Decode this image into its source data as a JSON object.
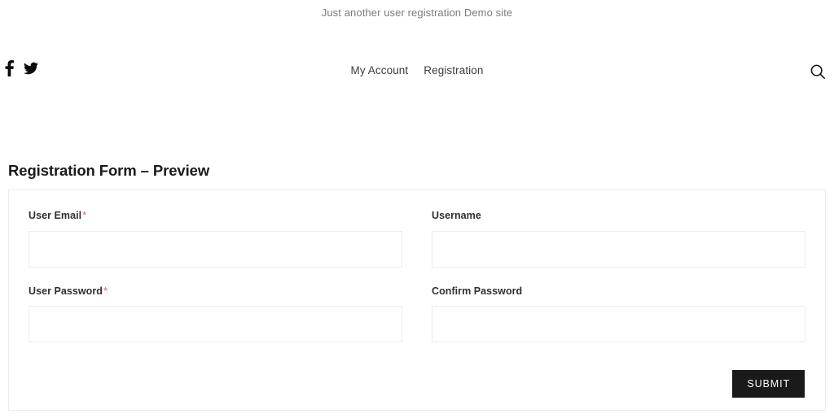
{
  "site": {
    "tagline": "Just another user registration Demo site"
  },
  "header": {
    "social": [
      {
        "name": "facebook",
        "label": "Facebook"
      },
      {
        "name": "twitter",
        "label": "Twitter"
      }
    ],
    "nav": [
      {
        "label": "My Account"
      },
      {
        "label": "Registration"
      }
    ],
    "search": {
      "label": "Search",
      "icon": "search-icon"
    }
  },
  "page": {
    "title": "Registration Form – Preview"
  },
  "form": {
    "fields": [
      {
        "key": "user_email",
        "label": "User Email",
        "required": true,
        "required_marker": "*",
        "value": "",
        "placeholder": "",
        "type": "email"
      },
      {
        "key": "username",
        "label": "Username",
        "required": false,
        "required_marker": "",
        "value": "",
        "placeholder": "",
        "type": "text"
      },
      {
        "key": "user_password",
        "label": "User Password",
        "required": true,
        "required_marker": "*",
        "value": "",
        "placeholder": "",
        "type": "password"
      },
      {
        "key": "confirm_password",
        "label": "Confirm Password",
        "required": false,
        "required_marker": "",
        "value": "",
        "placeholder": "",
        "type": "password"
      }
    ],
    "submit_label": "SUBMIT"
  },
  "colors": {
    "accent_required": "#f05a5a",
    "button_bg": "#1a1a1a",
    "button_text": "#ffffff",
    "border": "#ebebeb",
    "text_muted": "#7b7b7b"
  }
}
